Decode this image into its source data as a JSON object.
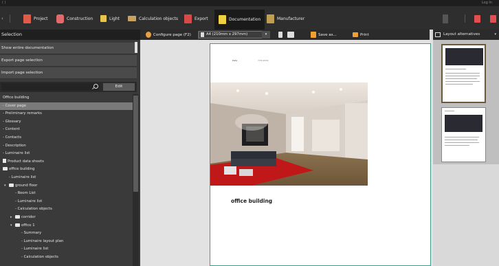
{
  "titlebar": {
    "left_text": "( )",
    "right_text": "Log In"
  },
  "ribbon": {
    "items": [
      {
        "label": "Project",
        "icon": "project-icon",
        "color": "#e05a4a"
      },
      {
        "label": "Construction",
        "icon": "construction-icon",
        "color": "#e36a6a"
      },
      {
        "label": "Light",
        "icon": "light-icon",
        "color": "#e8c44a"
      },
      {
        "label": "Calculation objects",
        "icon": "calculation-objects-icon",
        "color": "#c8a060"
      },
      {
        "label": "Export",
        "icon": "export-icon",
        "color": "#d84a4a"
      },
      {
        "label": "Documentation",
        "icon": "documentation-icon",
        "color": "#f0d040"
      },
      {
        "label": "Manufacturer",
        "icon": "manufacturer-icon",
        "color": "#c0a050"
      }
    ],
    "active": "Documentation"
  },
  "left_panel": {
    "title": "Selection",
    "actions": [
      "Show entire documentation",
      "Export page selection",
      "Import page selection"
    ],
    "search": {
      "placeholder": ""
    },
    "edit_label": "Edit",
    "tree": [
      {
        "label": "Office building",
        "indent": 0,
        "type": "text",
        "selected": false
      },
      {
        "label": "- Cover page",
        "indent": 0,
        "type": "text",
        "selected": true
      },
      {
        "label": "- Preliminary remarks",
        "indent": 0,
        "type": "text",
        "selected": false
      },
      {
        "label": "- Glossary",
        "indent": 0,
        "type": "text",
        "selected": false
      },
      {
        "label": "- Content",
        "indent": 0,
        "type": "text",
        "selected": false
      },
      {
        "label": "- Contacts",
        "indent": 0,
        "type": "text",
        "selected": false
      },
      {
        "label": "- Description",
        "indent": 0,
        "type": "text",
        "selected": false
      },
      {
        "label": "- Luminaire list",
        "indent": 0,
        "type": "text",
        "selected": false
      },
      {
        "label": "Product data sheets",
        "indent": 0,
        "type": "doc",
        "selected": false
      },
      {
        "label": "office building",
        "indent": 0,
        "type": "folder",
        "selected": false
      },
      {
        "label": "- Luminaire list",
        "indent": 1,
        "type": "text",
        "selected": false
      },
      {
        "label": "ground floor",
        "indent": 1,
        "type": "folder",
        "expanded": true,
        "selected": false
      },
      {
        "label": "- Room List",
        "indent": 2,
        "type": "text",
        "selected": false
      },
      {
        "label": "- Luminaire list",
        "indent": 2,
        "type": "text",
        "selected": false
      },
      {
        "label": "- Calculation objects",
        "indent": 2,
        "type": "text",
        "selected": false
      },
      {
        "label": "corridor",
        "indent": 2,
        "type": "folder",
        "expanded": false,
        "selected": false
      },
      {
        "label": "office 1",
        "indent": 2,
        "type": "folder",
        "expanded": true,
        "selected": false
      },
      {
        "label": "- Summary",
        "indent": 3,
        "type": "text",
        "selected": false
      },
      {
        "label": "- Luminaire layout plan",
        "indent": 3,
        "type": "text",
        "selected": false
      },
      {
        "label": "- Luminaire list",
        "indent": 3,
        "type": "text",
        "selected": false
      },
      {
        "label": "- Calculation objects",
        "indent": 3,
        "type": "text",
        "selected": false
      }
    ]
  },
  "toolbar": {
    "configure_label": "Configure page (F2)",
    "page_size": "A4 (210mm x 297mm)",
    "save_label": "Save as...",
    "print_label": "Print"
  },
  "page": {
    "meta_label": "Date",
    "meta_date": "7/31/2019",
    "title": "office building"
  },
  "right_panel": {
    "title": "Layout alternatives"
  }
}
